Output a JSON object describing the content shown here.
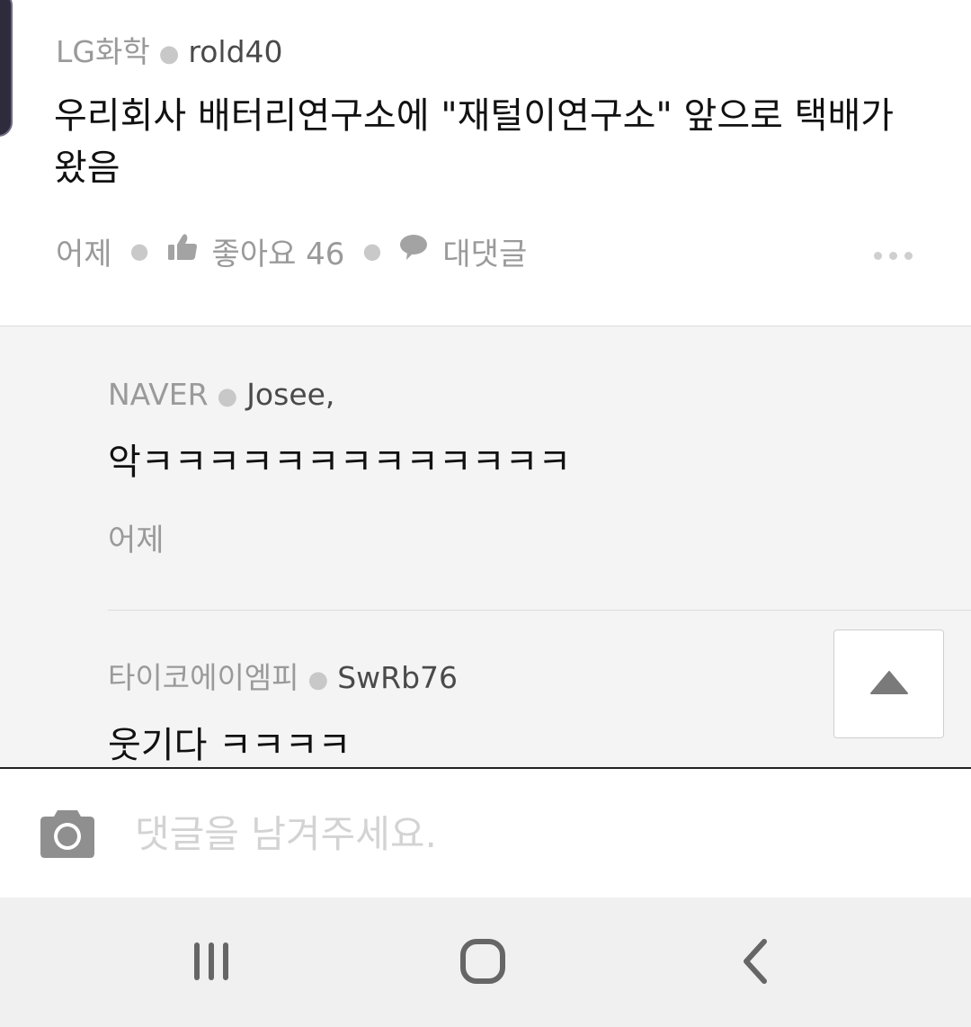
{
  "post": {
    "company": "LG화학",
    "nickname": "rold40",
    "body": "우리회사 배터리연구소에  \"재털이연구소\" 앞으로 택배가 왔음",
    "time": "어제",
    "like_label": "좋아요 46",
    "reply_label": "대댓글"
  },
  "replies": [
    {
      "company": "NAVER",
      "nickname": "Josee,",
      "text": "악ㅋㅋㅋㅋㅋㅋㅋㅋㅋㅋㅋㅋㅋ",
      "time": "어제"
    },
    {
      "company": "타이코에이엠피",
      "nickname": "SwRb76",
      "text": "웃기다 ㅋㅋㅋㅋ"
    }
  ],
  "composer": {
    "placeholder": "댓글을 남겨주세요."
  },
  "icons": {
    "like": "thumbs-up-icon",
    "reply": "speech-bubble-icon",
    "more": "more-dots-icon",
    "scroll_top": "triangle-up-icon",
    "camera": "camera-icon",
    "recents": "recent-apps-icon",
    "home": "home-icon",
    "back": "back-chevron-icon"
  },
  "colors": {
    "icon_gray": "#9a9a9a",
    "text_dark": "#111111",
    "divider": "#222222"
  }
}
